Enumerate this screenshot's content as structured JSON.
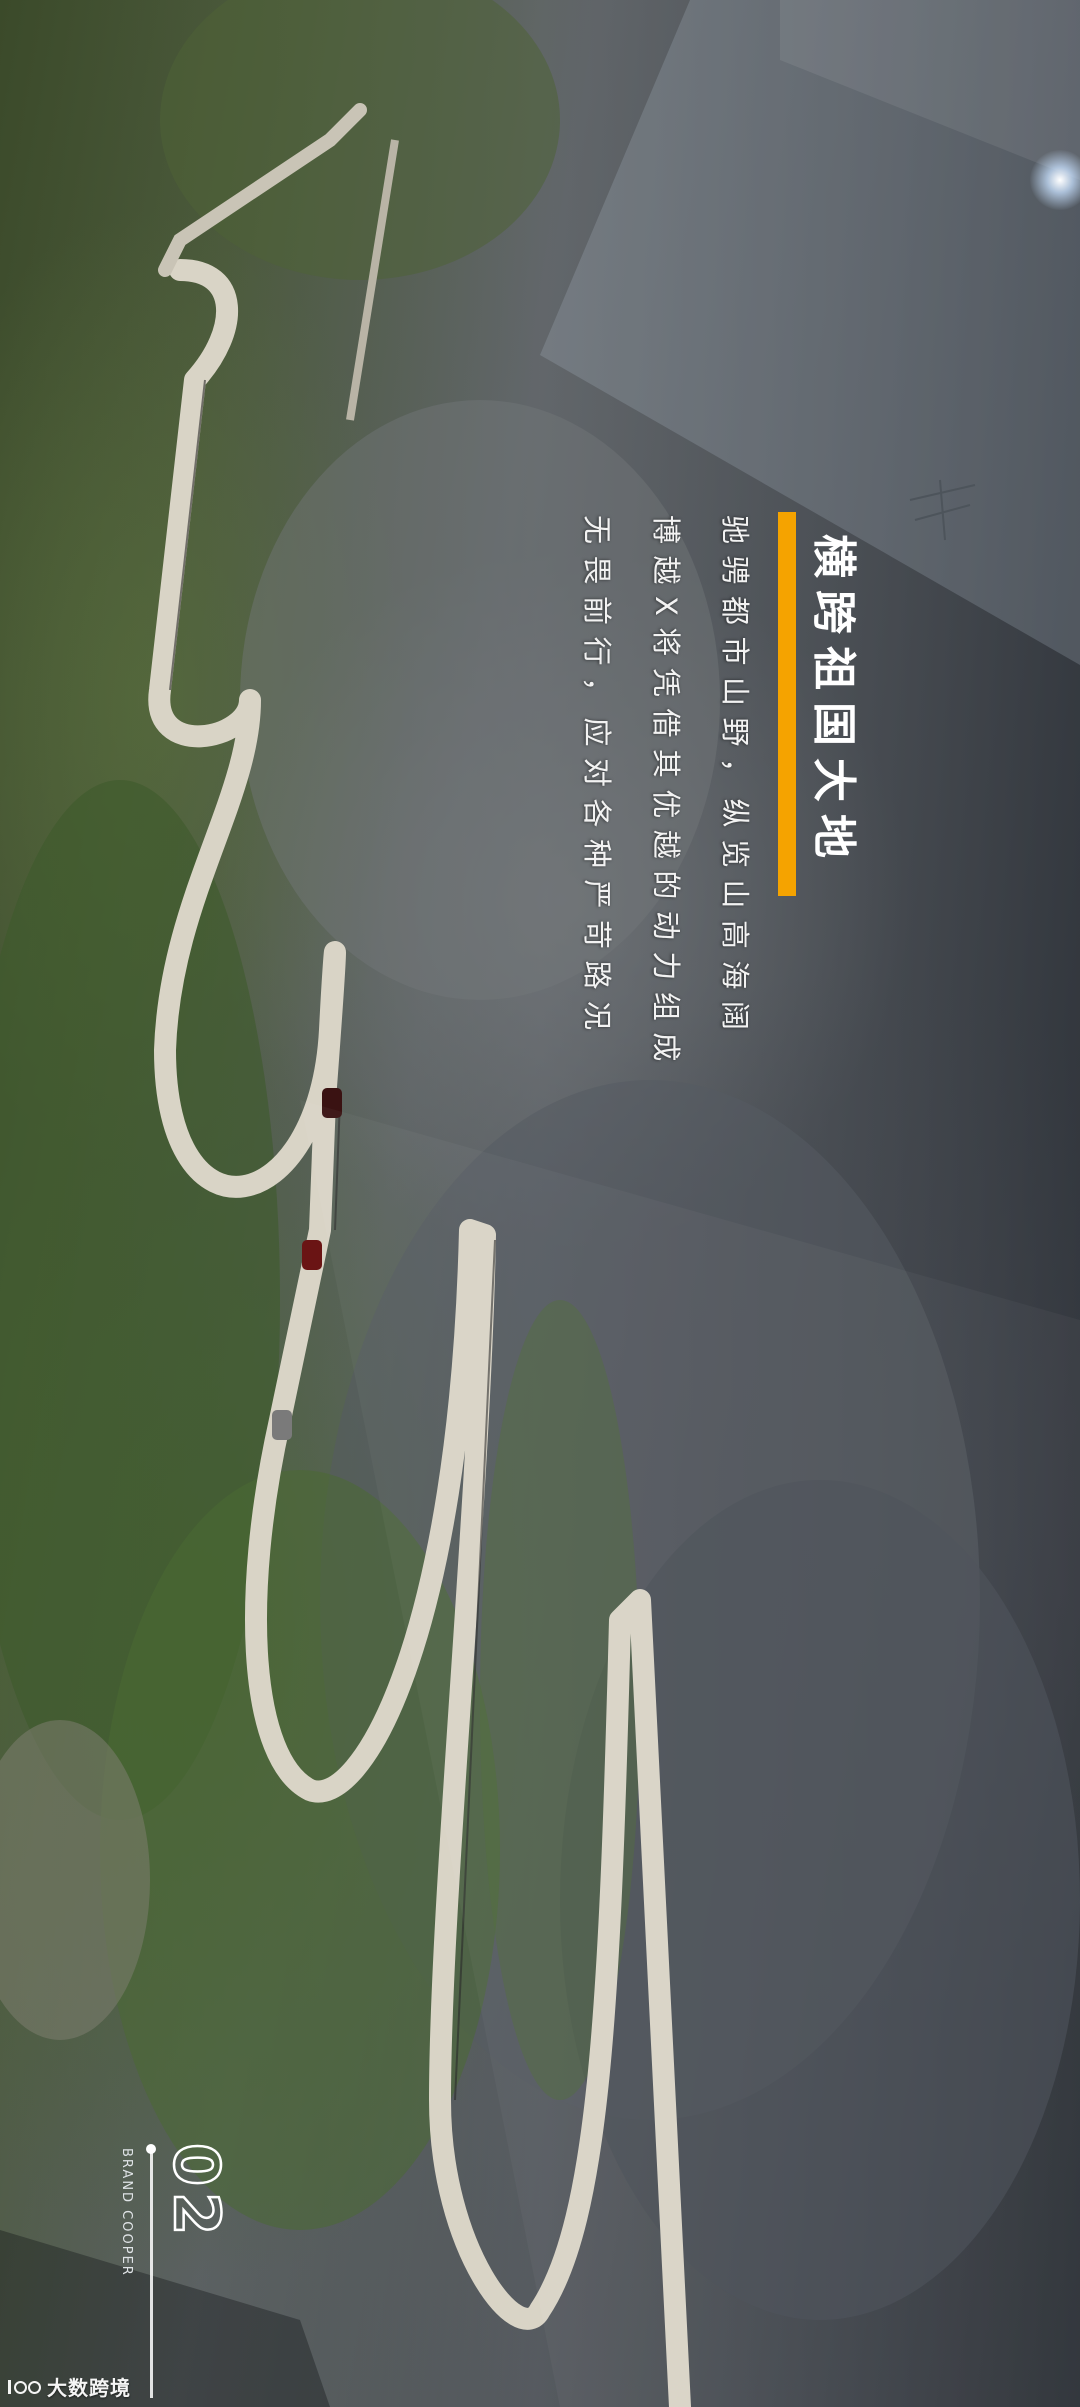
{
  "headline": "横跨祖国大地",
  "body_lines": [
    "驰骋都市山野，纵览山高海阔",
    "博越X将凭借其优越的动力组成",
    "无畏前行，应对各种严苛路况"
  ],
  "page_number": "02",
  "brand_caption": "BRAND COOPER",
  "watermark": "大数跨境",
  "colors": {
    "accent": "#f5a300",
    "text": "#ffffff"
  },
  "icons": {
    "watermark_logo": "brand-logo-icon",
    "lens_flare": "sun-flare-icon"
  }
}
